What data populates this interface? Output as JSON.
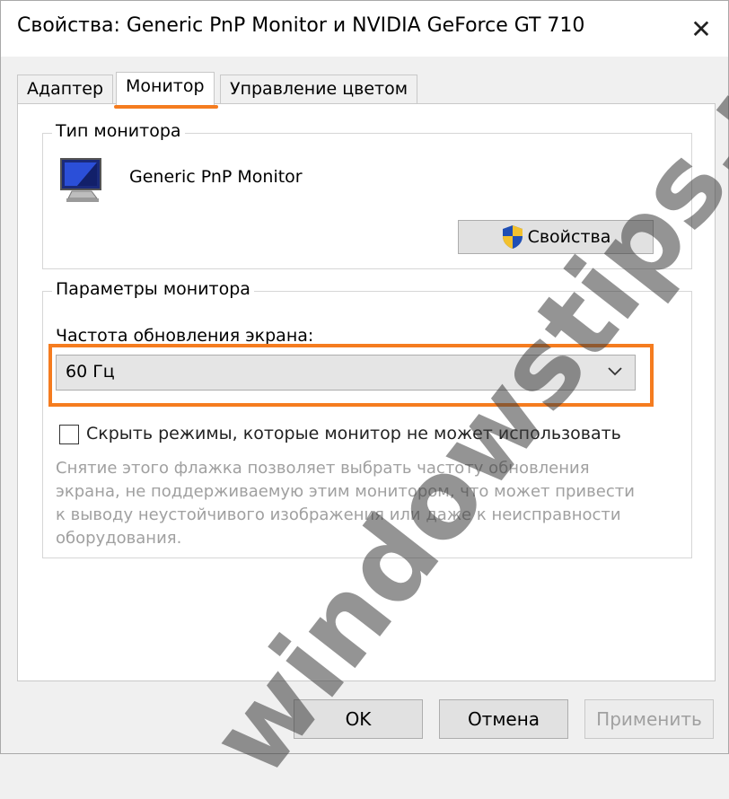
{
  "window": {
    "title": "Свойства: Generic PnP Monitor и NVIDIA GeForce GT 710",
    "close_glyph": "✕"
  },
  "tabs": [
    {
      "label": "Адаптер",
      "active": false
    },
    {
      "label": "Монитор",
      "active": true
    },
    {
      "label": "Управление цветом",
      "active": false
    }
  ],
  "monitor_type": {
    "group_label": "Тип монитора",
    "monitor_name": "Generic PnP Monitor",
    "properties_button": "Свойства",
    "icon": "monitor-icon",
    "button_icon": "uac-shield-icon"
  },
  "monitor_settings": {
    "group_label": "Параметры монитора",
    "refresh_rate_label": "Частота обновления экрана:",
    "refresh_rate_value": "60 Гц",
    "hide_modes_label": "Скрыть режимы, которые монитор не может использовать",
    "hide_modes_checked": false,
    "description": "Снятие этого флажка позволяет выбрать частоту обновления экрана, не поддерживаемую этим монитором, что может привести к выводу неустойчивого изображения или даже к неисправности оборудования."
  },
  "buttons": {
    "ok": "OK",
    "cancel": "Отмена",
    "apply": "Применить",
    "apply_enabled": false
  },
  "watermark": "windowstips.ru",
  "colors": {
    "highlight": "#f57c1f",
    "window_bg": "#f0f0f0",
    "panel_bg": "#ffffff"
  }
}
